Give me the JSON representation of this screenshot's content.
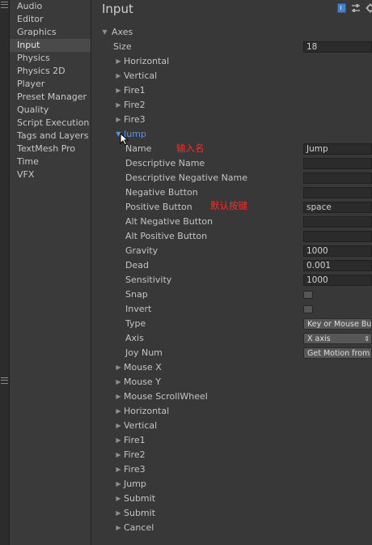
{
  "sidebar": {
    "items": [
      {
        "label": "Audio",
        "selected": false
      },
      {
        "label": "Editor",
        "selected": false
      },
      {
        "label": "Graphics",
        "selected": false
      },
      {
        "label": "Input",
        "selected": true
      },
      {
        "label": "Physics",
        "selected": false
      },
      {
        "label": "Physics 2D",
        "selected": false
      },
      {
        "label": "Player",
        "selected": false
      },
      {
        "label": "Preset Manager",
        "selected": false
      },
      {
        "label": "Quality",
        "selected": false
      },
      {
        "label": "Script Execution Order",
        "selected": false
      },
      {
        "label": "Tags and Layers",
        "selected": false
      },
      {
        "label": "TextMesh Pro",
        "selected": false
      },
      {
        "label": "Time",
        "selected": false
      },
      {
        "label": "VFX",
        "selected": false
      }
    ]
  },
  "header": {
    "title": "Input",
    "icons": [
      "help-book-icon",
      "presets-icon",
      "gear-icon"
    ]
  },
  "axes": {
    "label": "Axes",
    "expanded": true,
    "size_label": "Size",
    "size_value": "18",
    "items_before": [
      "Horizontal",
      "Vertical",
      "Fire1",
      "Fire2",
      "Fire3"
    ],
    "jump": {
      "label": "Jump",
      "expanded": true,
      "name_label": "Name",
      "name_value": "Jump",
      "descriptive_name_label": "Descriptive Name",
      "descriptive_name_value": "",
      "descriptive_negative_name_label": "Descriptive Negative Name",
      "descriptive_negative_name_value": "",
      "negative_button_label": "Negative Button",
      "negative_button_value": "",
      "positive_button_label": "Positive Button",
      "positive_button_value": "space",
      "alt_negative_button_label": "Alt Negative Button",
      "alt_negative_button_value": "",
      "alt_positive_button_label": "Alt Positive Button",
      "alt_positive_button_value": "",
      "gravity_label": "Gravity",
      "gravity_value": "1000",
      "dead_label": "Dead",
      "dead_value": "0.001",
      "sensitivity_label": "Sensitivity",
      "sensitivity_value": "1000",
      "snap_label": "Snap",
      "snap_checked": false,
      "invert_label": "Invert",
      "invert_checked": false,
      "type_label": "Type",
      "type_value": "Key or Mouse Button",
      "axis_label": "Axis",
      "axis_value": "X axis",
      "joy_num_label": "Joy Num",
      "joy_num_value": "Get Motion from all Joysticks"
    },
    "items_after": [
      "Mouse X",
      "Mouse Y",
      "Mouse ScrollWheel",
      "Horizontal",
      "Vertical",
      "Fire1",
      "Fire2",
      "Fire3",
      "Jump",
      "Submit",
      "Submit",
      "Cancel"
    ]
  },
  "annotations": {
    "name_note": "输入名",
    "positive_button_note": "默认按键"
  },
  "colors": {
    "background": "#383838",
    "field": "#2b2b2b",
    "selected_item": "#4a4a4a",
    "active_foldout": "#5d8fe6",
    "annotation": "#ff2a2a"
  }
}
